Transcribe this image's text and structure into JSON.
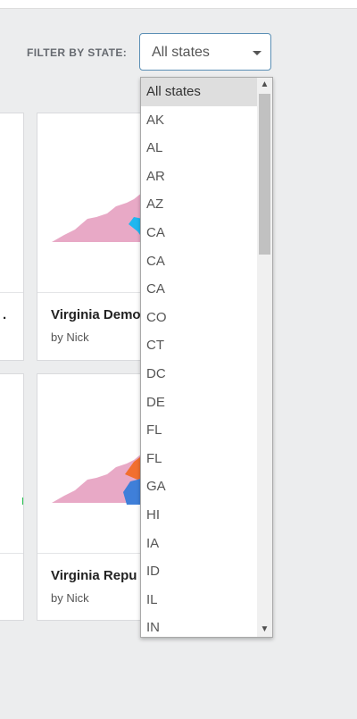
{
  "filter": {
    "label": "FILTER BY STATE:",
    "selected": "All states"
  },
  "cards": [
    {
      "title": ".",
      "author": ""
    },
    {
      "title": "Virginia Demo",
      "author": "by Nick"
    },
    {
      "title": "",
      "author": ""
    },
    {
      "title": "Virginia Repu",
      "author": "by Nick"
    }
  ],
  "dropdown": {
    "options": [
      "All states",
      "AK",
      "AL",
      "AR",
      "AZ",
      "CA",
      "CA",
      "CA",
      "CO",
      "CT",
      "DC",
      "DE",
      "FL",
      "FL",
      "GA",
      "HI",
      "IA",
      "ID",
      "IL",
      "IN"
    ]
  },
  "colors": {
    "map_base": "#e8a9c6",
    "map_highlight_blue": "#1fb7f0",
    "map_orange": "#f26f2f",
    "map_blue": "#3f7fd9",
    "map_green": "#1fbf4a"
  }
}
